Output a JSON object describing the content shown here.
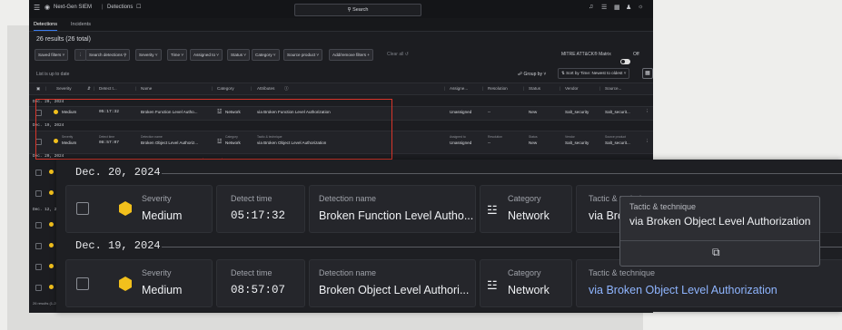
{
  "app": {
    "logo": "Next-Gen SIEM",
    "section": "Detections",
    "search_label": "Search",
    "tabs": [
      {
        "label": "Detections",
        "active": true
      },
      {
        "label": "Incidents",
        "active": false
      }
    ]
  },
  "results_count": "26 results (26 total)",
  "filters": [
    "Saved filters",
    "Search detections",
    "Severity",
    "Time",
    "Assigned to",
    "Status",
    "Category",
    "Source product",
    "Add/remove filters"
  ],
  "clear_all": "Clear all",
  "mitre_label": "MITRE ATT&CK® Matrix",
  "mitre_state": "Off",
  "list_note": "List is up to date",
  "group_by": "Group by",
  "sort_label": "Sort by Time: Newest to oldest",
  "columns": [
    "Severity",
    "Detect t...",
    "Name",
    "Category",
    "Attributes",
    "Assigne...",
    "Resolution",
    "Status",
    "Vendor",
    "Source..."
  ],
  "rows": [
    {
      "date": "Dec. 20, 2024",
      "severity": "Medium",
      "time": "05:17:32",
      "name": "Broken Function Level Autho...",
      "category": "Network",
      "tactic": "via Broken Function Level Authorization",
      "assigned": "Unassigned",
      "resolution": "--",
      "status": "New",
      "vendor": "Salt_security",
      "source": "Salt_securit..."
    },
    {
      "date": "Dec. 19, 2024",
      "severity": "Medium",
      "time": "08:57:07",
      "name": "Broken Object Level Authoriz...",
      "category": "Network",
      "tactic": "via Broken Object Level Authorization",
      "assigned": "Unassigned",
      "resolution": "--",
      "status": "New",
      "vendor": "Salt_security",
      "source": "Salt_securit..."
    }
  ],
  "row_sublabels": {
    "severity": "Severity",
    "time": "Detect time",
    "name": "Detection name",
    "category": "Category",
    "tactic": "Tactic & technique",
    "assigned": "Assigned to",
    "resolution": "Resolution",
    "status": "Status",
    "vendor": "Vendor",
    "source": "Source product"
  },
  "background_dates": [
    "Dec. 20, 2024",
    "Dec. 12, 2024"
  ],
  "footer": "26 results (1-25)",
  "zoom": {
    "groups": [
      {
        "date": "Dec. 20, 2024",
        "severity_label": "Severity",
        "severity": "Medium",
        "time_label": "Detect time",
        "time": "05:17:32",
        "name_label": "Detection name",
        "name": "Broken Function Level Autho...",
        "category_label": "Category",
        "category": "Network",
        "tactic_label": "Tactic & technique",
        "tactic": "via Bro"
      },
      {
        "date": "Dec. 19, 2024",
        "severity_label": "Severity",
        "severity": "Medium",
        "time_label": "Detect time",
        "time": "08:57:07",
        "name_label": "Detection name",
        "name": "Broken Object Level Authori...",
        "category_label": "Category",
        "category": "Network",
        "tactic_label": "Tactic & technique",
        "tactic": "via Broken Object Level Authorization"
      }
    ],
    "tooltip": {
      "label": "Tactic & technique",
      "value": "via Broken Object Level Authorization"
    }
  },
  "colors": {
    "severity_medium": "#f2c01c",
    "highlight_box": "#d8352a",
    "link": "#8fb5ff"
  }
}
